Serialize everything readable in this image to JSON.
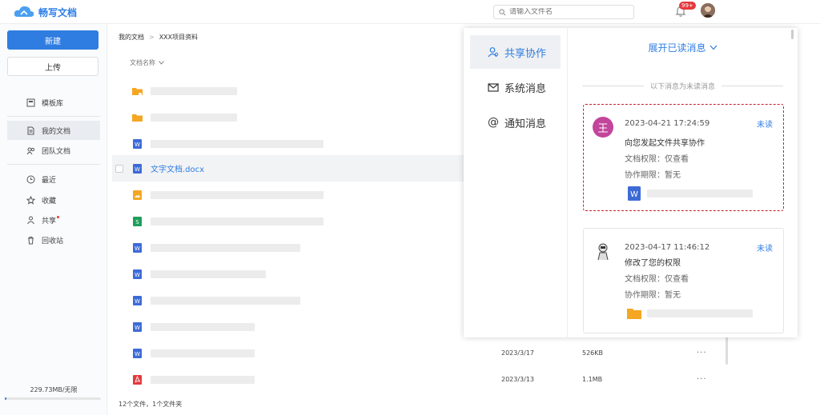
{
  "app": {
    "name": "畅写文档"
  },
  "search": {
    "placeholder": "请输入文件名",
    "value": ""
  },
  "notifications": {
    "badge": "99+"
  },
  "sidebar": {
    "new_label": "新建",
    "upload_label": "上传",
    "items": [
      {
        "label": "模板库",
        "icon": "template-icon"
      },
      {
        "label": "我的文档",
        "icon": "document-icon"
      },
      {
        "label": "团队文档",
        "icon": "team-icon"
      },
      {
        "label": "最近",
        "icon": "clock-icon"
      },
      {
        "label": "收藏",
        "icon": "star-icon"
      },
      {
        "label": "共享",
        "icon": "share-icon"
      },
      {
        "label": "回收站",
        "icon": "trash-icon"
      }
    ],
    "storage": "229.73MB/无限",
    "storage_used_fraction": 0.02
  },
  "breadcrumb": {
    "root": "我的文档",
    "sep": ">",
    "current": "XXX项目资料"
  },
  "file_list": {
    "header": "文档名称",
    "highlighted_file": "文字文档.docx",
    "rows": [
      {
        "date": "2023/3/17",
        "size": "526KB"
      },
      {
        "date": "2023/3/13",
        "size": "1.1MB"
      }
    ],
    "footer": "12个文件，1个文件夹"
  },
  "panel": {
    "tabs": [
      {
        "label": "共享协作",
        "icon": "user-share-icon"
      },
      {
        "label": "系统消息",
        "icon": "mail-icon"
      },
      {
        "label": "通知消息",
        "icon": "at-icon"
      }
    ],
    "expand_label": "展开已读消息",
    "divider_text": "以下消息为未读消息",
    "cards": [
      {
        "avatar_text": "王",
        "time": "2023-04-21 17:24:59",
        "status": "未读",
        "action": "向您发起文件共享协作",
        "permission": "文档权限：仅查看",
        "period": "协作期限：暂无"
      },
      {
        "avatar_text": "",
        "time": "2023-04-17 11:46:12",
        "status": "未读",
        "action": "修改了您的权限",
        "permission": "文档权限：仅查看",
        "period": "协作期限：暂无"
      }
    ]
  },
  "colors": {
    "accent": "#2f7de1",
    "alert": "#e4393c",
    "selection_border": "#c81e2d"
  }
}
